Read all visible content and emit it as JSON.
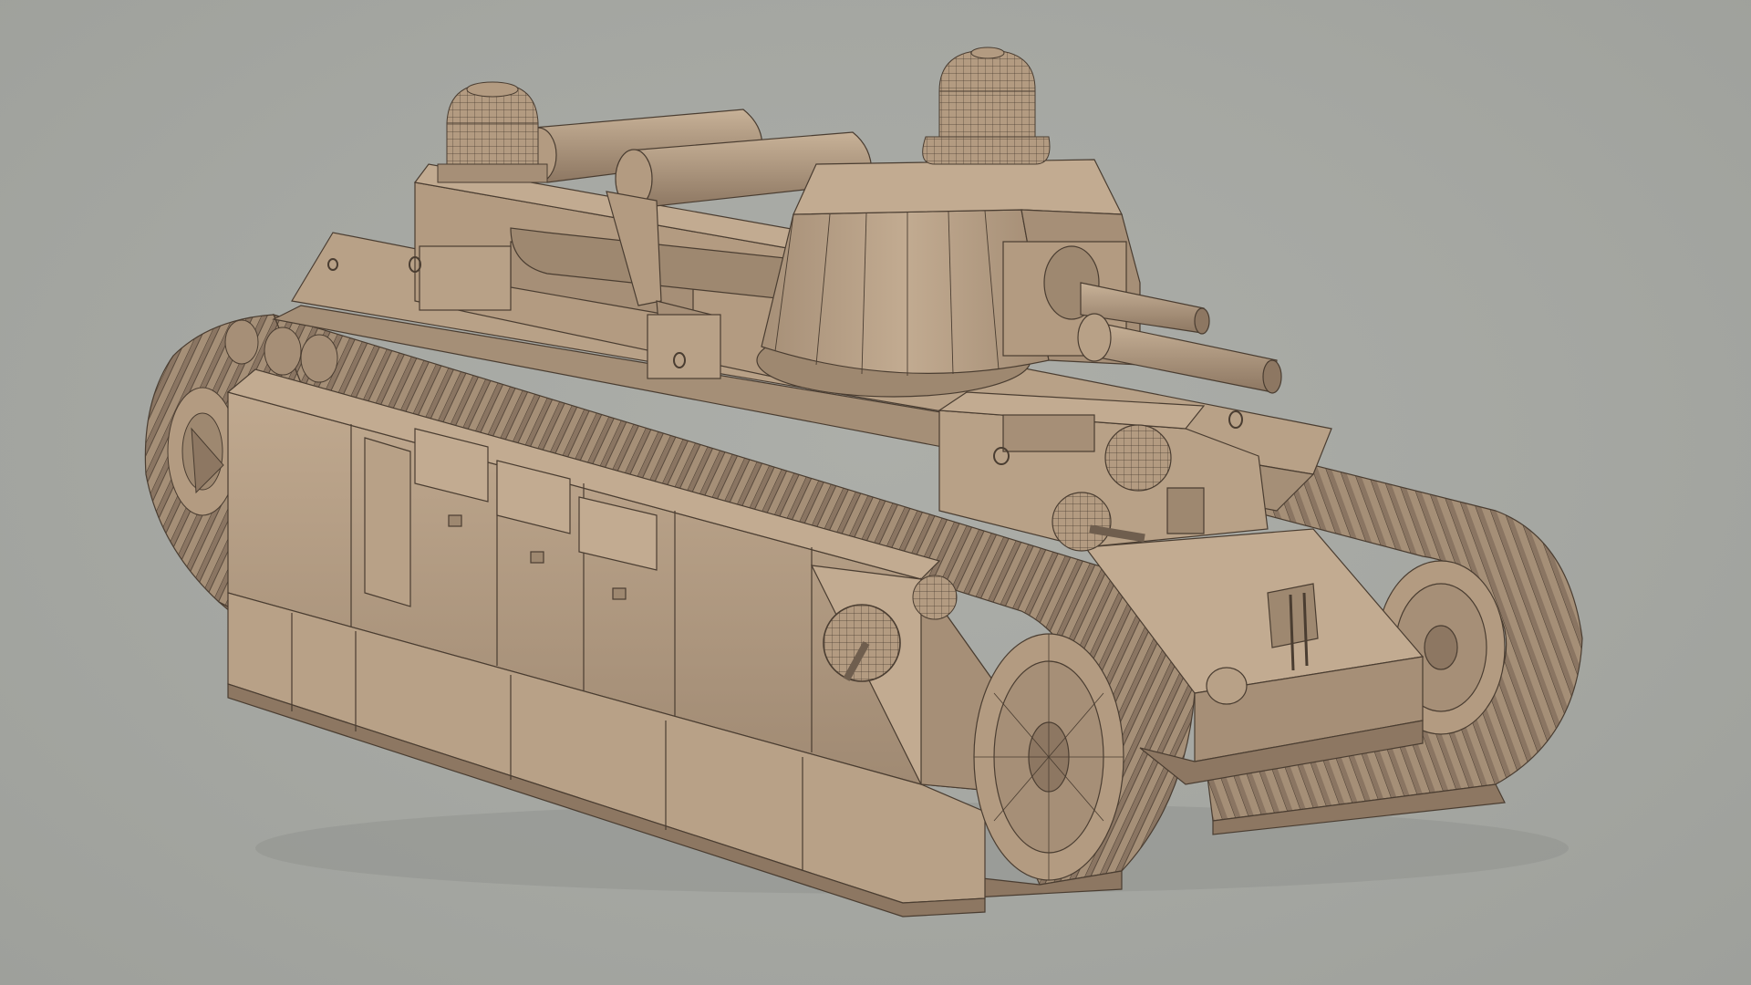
{
  "scene": {
    "background_color": "#a6a8a3",
    "model": {
      "subject": "tank-model",
      "base_color": "#b39b81",
      "light_color": "#c2ab91",
      "dark_color": "#8d7762",
      "shadow_color": "#6f5e4e",
      "wire_color": "#4a3d31",
      "display_mode": "wireframe-on-shaded"
    }
  }
}
